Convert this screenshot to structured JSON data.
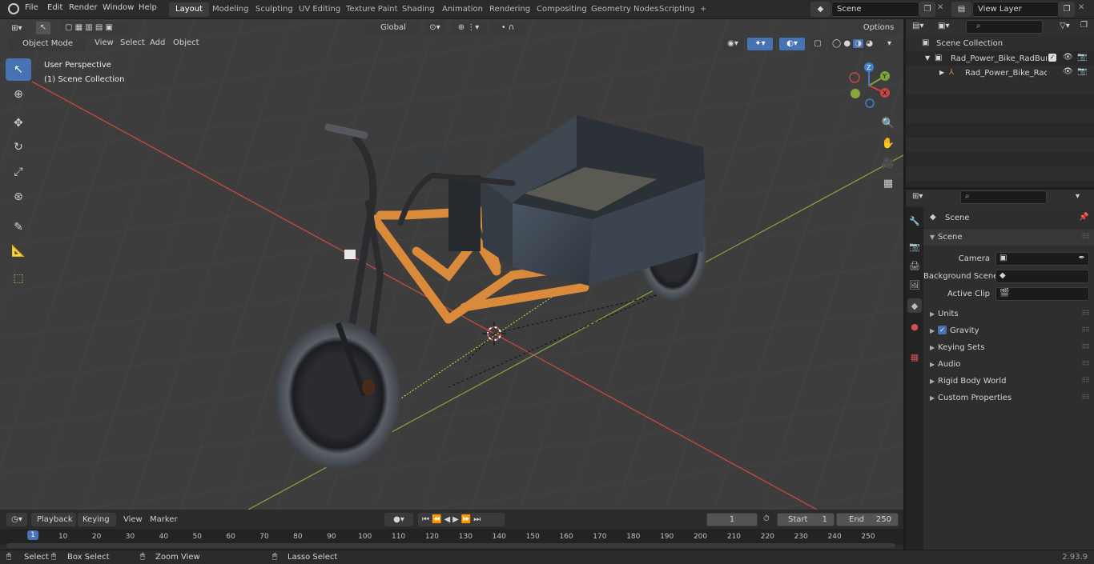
{
  "app": {
    "menus": [
      "File",
      "Edit",
      "Render",
      "Window",
      "Help"
    ],
    "workspaces": [
      "Layout",
      "Modeling",
      "Sculpting",
      "UV Editing",
      "Texture Paint",
      "Shading",
      "Animation",
      "Rendering",
      "Compositing",
      "Geometry Nodes",
      "Scripting"
    ],
    "active_workspace": "Layout",
    "scene": "Scene",
    "view_layer": "View Layer"
  },
  "viewport": {
    "mode": "Object Mode",
    "menus": [
      "View",
      "Select",
      "Add",
      "Object"
    ],
    "orientation": "Global",
    "options": "Options",
    "overlay_title": "User Perspective",
    "overlay_subtitle": "(1) Scene Collection",
    "gizmo": {
      "x": "X",
      "y": "Y",
      "z": "Z"
    }
  },
  "outliner": {
    "search_placeholder": "",
    "root": "Scene Collection",
    "items": [
      {
        "label": "Rad_Power_Bike_RadBurro_v"
      },
      {
        "label": "Rad_Power_Bike_RadBu"
      }
    ]
  },
  "properties": {
    "title": "Scene",
    "panel": "Scene",
    "fields": [
      {
        "label": "Camera",
        "value": ""
      },
      {
        "label": "Background Scene",
        "value": ""
      },
      {
        "label": "Active Clip",
        "value": ""
      }
    ],
    "sections": [
      "Units",
      "Gravity",
      "Keying Sets",
      "Audio",
      "Rigid Body World",
      "Custom Properties"
    ],
    "gravity_checked": true
  },
  "timeline": {
    "menus": [
      "Playback",
      "Keying",
      "View",
      "Marker"
    ],
    "current_frame": "1",
    "start_label": "Start",
    "start": "1",
    "end_label": "End",
    "end": "250",
    "ticks": [
      "1",
      "10",
      "20",
      "30",
      "40",
      "50",
      "60",
      "70",
      "80",
      "90",
      "100",
      "110",
      "120",
      "130",
      "140",
      "150",
      "160",
      "170",
      "180",
      "190",
      "200",
      "210",
      "220",
      "230",
      "240",
      "250"
    ]
  },
  "status": {
    "select": "Select",
    "box_select": "Box Select",
    "zoom": "Zoom View",
    "lasso": "Lasso Select",
    "version": "2.93.9"
  },
  "colors": {
    "accent": "#4772b3",
    "frame_orange": "#d98a3a",
    "x_axis": "#c8483f",
    "y_axis": "#7ea23a"
  }
}
